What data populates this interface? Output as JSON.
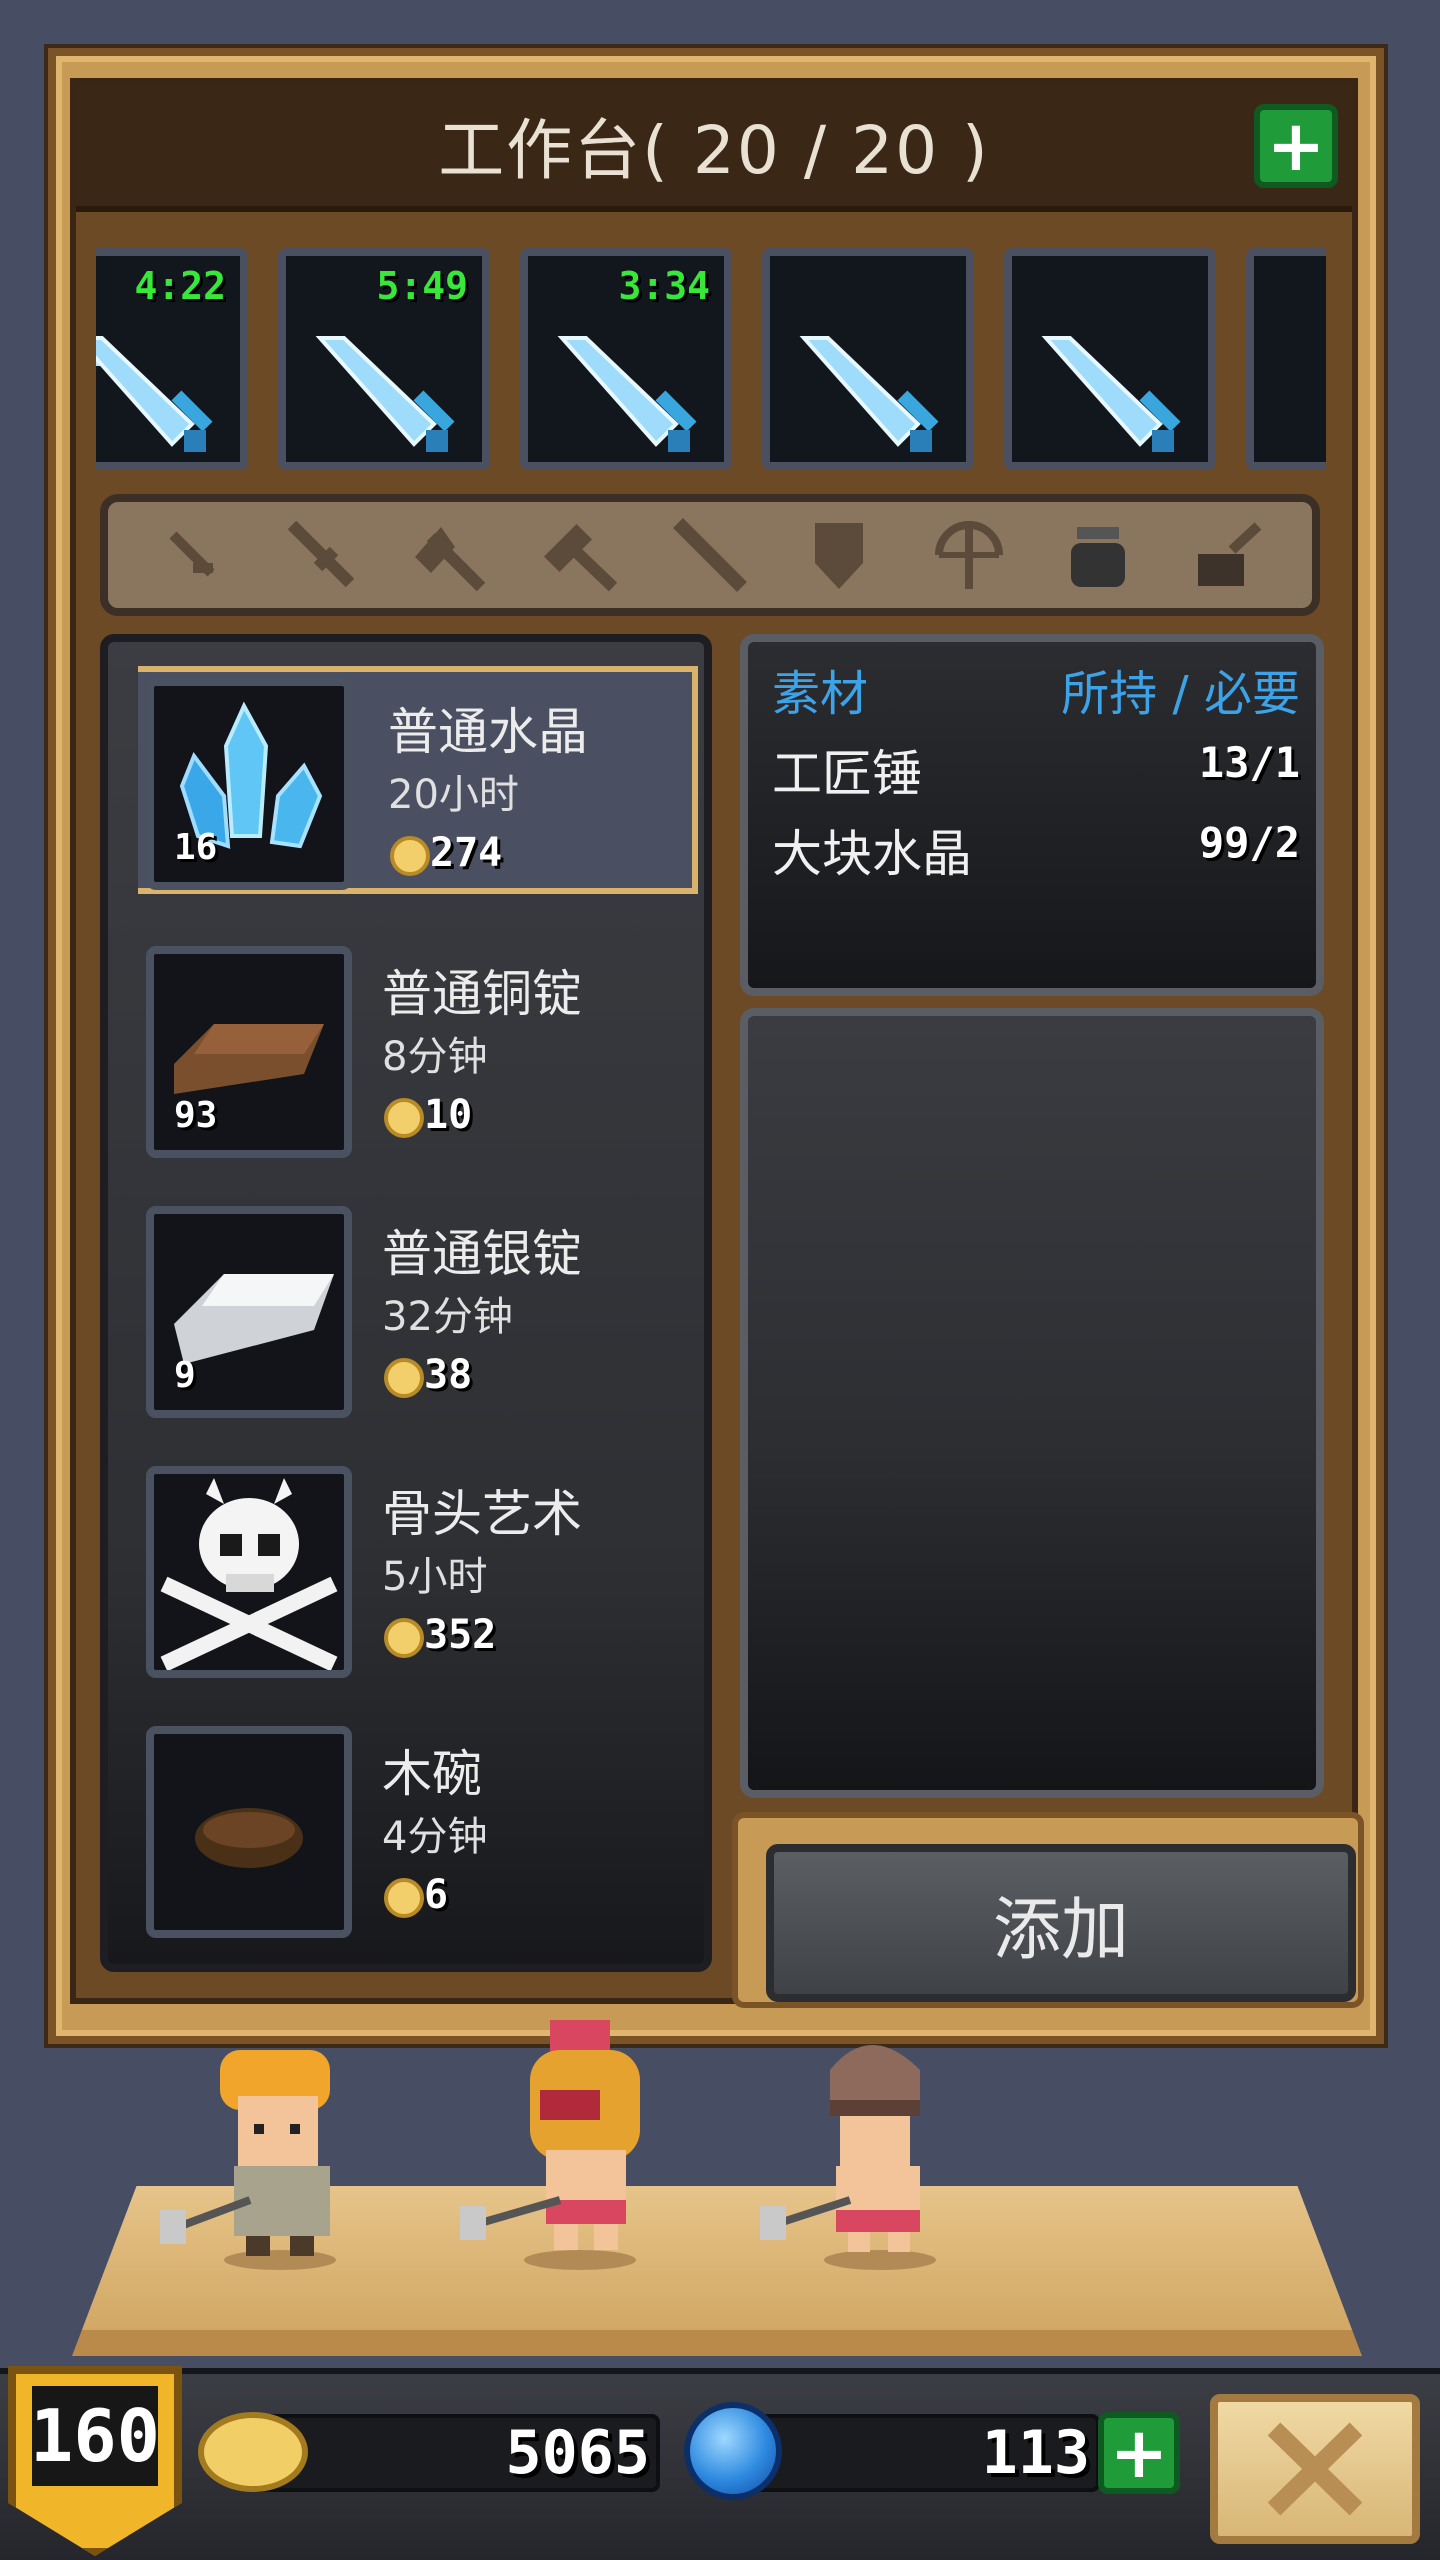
{
  "workbench": {
    "title": "工作台( 20 / 20 )",
    "add_slot_icon": "plus-icon"
  },
  "queue": [
    {
      "timer": "4:22",
      "icon": "ice-sword-icon"
    },
    {
      "timer": "5:49",
      "icon": "ice-sword-icon"
    },
    {
      "timer": "3:34",
      "icon": "ice-sword-icon"
    },
    {
      "timer": "",
      "icon": "ice-sword-icon"
    },
    {
      "timer": "",
      "icon": "ice-sword-icon"
    }
  ],
  "categories": [
    "dagger-icon",
    "sword-icon",
    "axe-icon",
    "hammer-icon",
    "staff-icon",
    "shield-icon",
    "bow-icon",
    "pot-icon",
    "misc-icon"
  ],
  "recipes": [
    {
      "name": "普通水晶",
      "time": "20小时",
      "qty": "16",
      "price": "274",
      "icon": "crystal-icon"
    },
    {
      "name": "普通铜锭",
      "time": "8分钟",
      "qty": "93",
      "price": "10",
      "icon": "copper-ingot-icon"
    },
    {
      "name": "普通银锭",
      "time": "32分钟",
      "qty": "9",
      "price": "38",
      "icon": "silver-ingot-icon"
    },
    {
      "name": "骨头艺术",
      "time": "5小时",
      "qty": "",
      "price": "352",
      "icon": "skull-crossbones-icon"
    },
    {
      "name": "木碗",
      "time": "4分钟",
      "qty": "",
      "price": "6",
      "icon": "wooden-bowl-icon"
    }
  ],
  "materials": {
    "header_left": "素材",
    "header_right": "所持 / 必要",
    "rows": [
      {
        "name": "工匠锤",
        "value": "13/1"
      },
      {
        "name": "大块水晶",
        "value": "99/2"
      }
    ]
  },
  "add_button_label": "添加",
  "footer": {
    "level": "160",
    "gold": "5065",
    "gems": "113"
  },
  "colors": {
    "accent_blue": "#3da3e8",
    "timer_green": "#38e838",
    "frame_gold": "#c79a55",
    "plus_green": "#1f9b3a"
  }
}
